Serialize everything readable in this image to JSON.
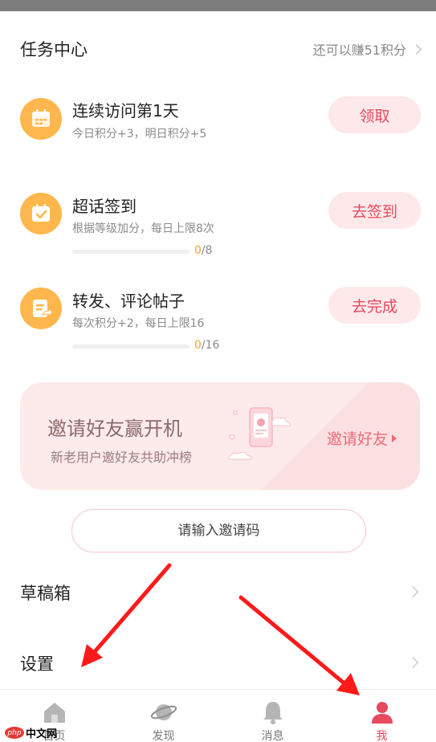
{
  "task_center": {
    "title": "任务中心",
    "earn_text": "还可以赚51积分"
  },
  "tasks": [
    {
      "name": "连续访问第1天",
      "desc": "今日积分+3，明日积分+5",
      "button": "领取"
    },
    {
      "name": "超话签到",
      "desc": "根据等级加分，每日上限8次",
      "progress_current": "0",
      "progress_total": "/8",
      "progress_value": 0,
      "button": "去签到"
    },
    {
      "name": "转发、评论帖子",
      "desc": "每次积分+2，每日上限16",
      "progress_current": "0",
      "progress_total": "/16",
      "progress_value": 0,
      "button": "去完成"
    }
  ],
  "invite": {
    "title": "邀请好友赢开机",
    "subtitle": "新老用户邀好友共助冲榜",
    "link": "邀请好友"
  },
  "invite_code": {
    "placeholder": "请输入邀请码"
  },
  "menu": {
    "drafts": "草稿箱",
    "settings": "设置"
  },
  "tabs": [
    {
      "label": "首页"
    },
    {
      "label": "发现"
    },
    {
      "label": "消息"
    },
    {
      "label": "我"
    }
  ],
  "watermark": {
    "badge": "php",
    "text": "中文网"
  },
  "colors": {
    "accent": "#e64a5e",
    "button_bg": "#fde8ea",
    "icon_orange": "#ffb74d",
    "progress_text": "#f5a623",
    "arrow_red": "#ff1a1a"
  }
}
